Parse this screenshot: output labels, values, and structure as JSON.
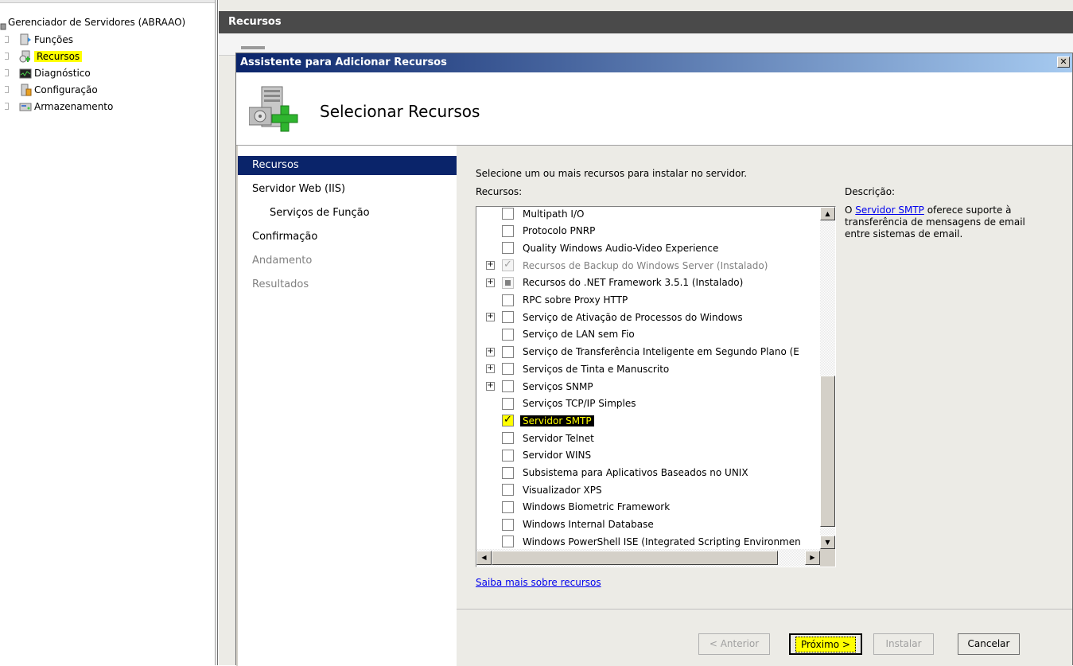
{
  "tree": {
    "root_label": "Gerenciador de Servidores (ABRAAO)",
    "items": [
      {
        "label": "Funções",
        "icon": "roles-icon",
        "highlighted": false
      },
      {
        "label": "Recursos",
        "icon": "features-icon",
        "highlighted": true
      },
      {
        "label": "Diagnóstico",
        "icon": "diagnostics-icon",
        "highlighted": false
      },
      {
        "label": "Configuração",
        "icon": "configuration-icon",
        "highlighted": false
      },
      {
        "label": "Armazenamento",
        "icon": "storage-icon",
        "highlighted": false
      }
    ]
  },
  "right_pane": {
    "header": "Recursos"
  },
  "dialog": {
    "title": "Assistente para Adicionar Recursos",
    "close_label": "✕",
    "page_title": "Selecionar Recursos",
    "nav": [
      {
        "label": "Recursos",
        "state": "active"
      },
      {
        "label": "Servidor Web (IIS)",
        "state": "normal"
      },
      {
        "label": "Serviços de Função",
        "state": "normal"
      },
      {
        "label": "Confirmação",
        "state": "normal"
      },
      {
        "label": "Andamento",
        "state": "disabled"
      },
      {
        "label": "Resultados",
        "state": "disabled"
      }
    ],
    "instruction": "Selecione um ou mais recursos para instalar no servidor.",
    "features_label": "Recursos:",
    "description_label": "Descrição:",
    "description": {
      "prefix": "O ",
      "link": "Servidor SMTP",
      "suffix": " oferece suporte à transferência de mensagens de email entre sistemas de email."
    },
    "features": [
      {
        "label": "Multipath I/O",
        "state": "unchecked",
        "expandable": false
      },
      {
        "label": "Protocolo PNRP",
        "state": "unchecked",
        "expandable": false
      },
      {
        "label": "Quality Windows Audio-Video Experience",
        "state": "unchecked",
        "expandable": false
      },
      {
        "label": "Recursos de Backup do Windows Server  (Instalado)",
        "state": "checked-disabled",
        "expandable": true
      },
      {
        "label": "Recursos do .NET Framework 3.5.1  (Instalado)",
        "state": "indeterminate",
        "expandable": true
      },
      {
        "label": "RPC sobre Proxy HTTP",
        "state": "unchecked",
        "expandable": false
      },
      {
        "label": "Serviço de Ativação de Processos do Windows",
        "state": "unchecked",
        "expandable": true
      },
      {
        "label": "Serviço de LAN sem Fio",
        "state": "unchecked",
        "expandable": false
      },
      {
        "label": "Serviço de Transferência Inteligente em Segundo Plano (E",
        "state": "unchecked",
        "expandable": true
      },
      {
        "label": "Serviços de Tinta e Manuscrito",
        "state": "unchecked",
        "expandable": true
      },
      {
        "label": "Serviços SNMP",
        "state": "unchecked",
        "expandable": true
      },
      {
        "label": "Serviços TCP/IP Simples",
        "state": "unchecked",
        "expandable": false
      },
      {
        "label": "Servidor SMTP",
        "state": "checked",
        "expandable": false,
        "highlighted": true
      },
      {
        "label": "Servidor Telnet",
        "state": "unchecked",
        "expandable": false
      },
      {
        "label": "Servidor WINS",
        "state": "unchecked",
        "expandable": false
      },
      {
        "label": "Subsistema para Aplicativos Baseados no UNIX",
        "state": "unchecked",
        "expandable": false
      },
      {
        "label": "Visualizador XPS",
        "state": "unchecked",
        "expandable": false
      },
      {
        "label": "Windows Biometric Framework",
        "state": "unchecked",
        "expandable": false
      },
      {
        "label": "Windows Internal Database",
        "state": "unchecked",
        "expandable": false
      },
      {
        "label": "Windows PowerShell ISE (Integrated Scripting Environmen",
        "state": "unchecked",
        "expandable": false
      }
    ],
    "more_link": "Saiba mais sobre recursos",
    "buttons": {
      "back": "< Anterior",
      "next": "Próximo >",
      "install": "Instalar",
      "cancel": "Cancelar"
    }
  },
  "colors": {
    "title_gradient_start": "#0a246a",
    "title_gradient_end": "#a6caf0",
    "highlight": "#ffff00",
    "nav_active": "#0a246a",
    "link": "#0000ee"
  }
}
